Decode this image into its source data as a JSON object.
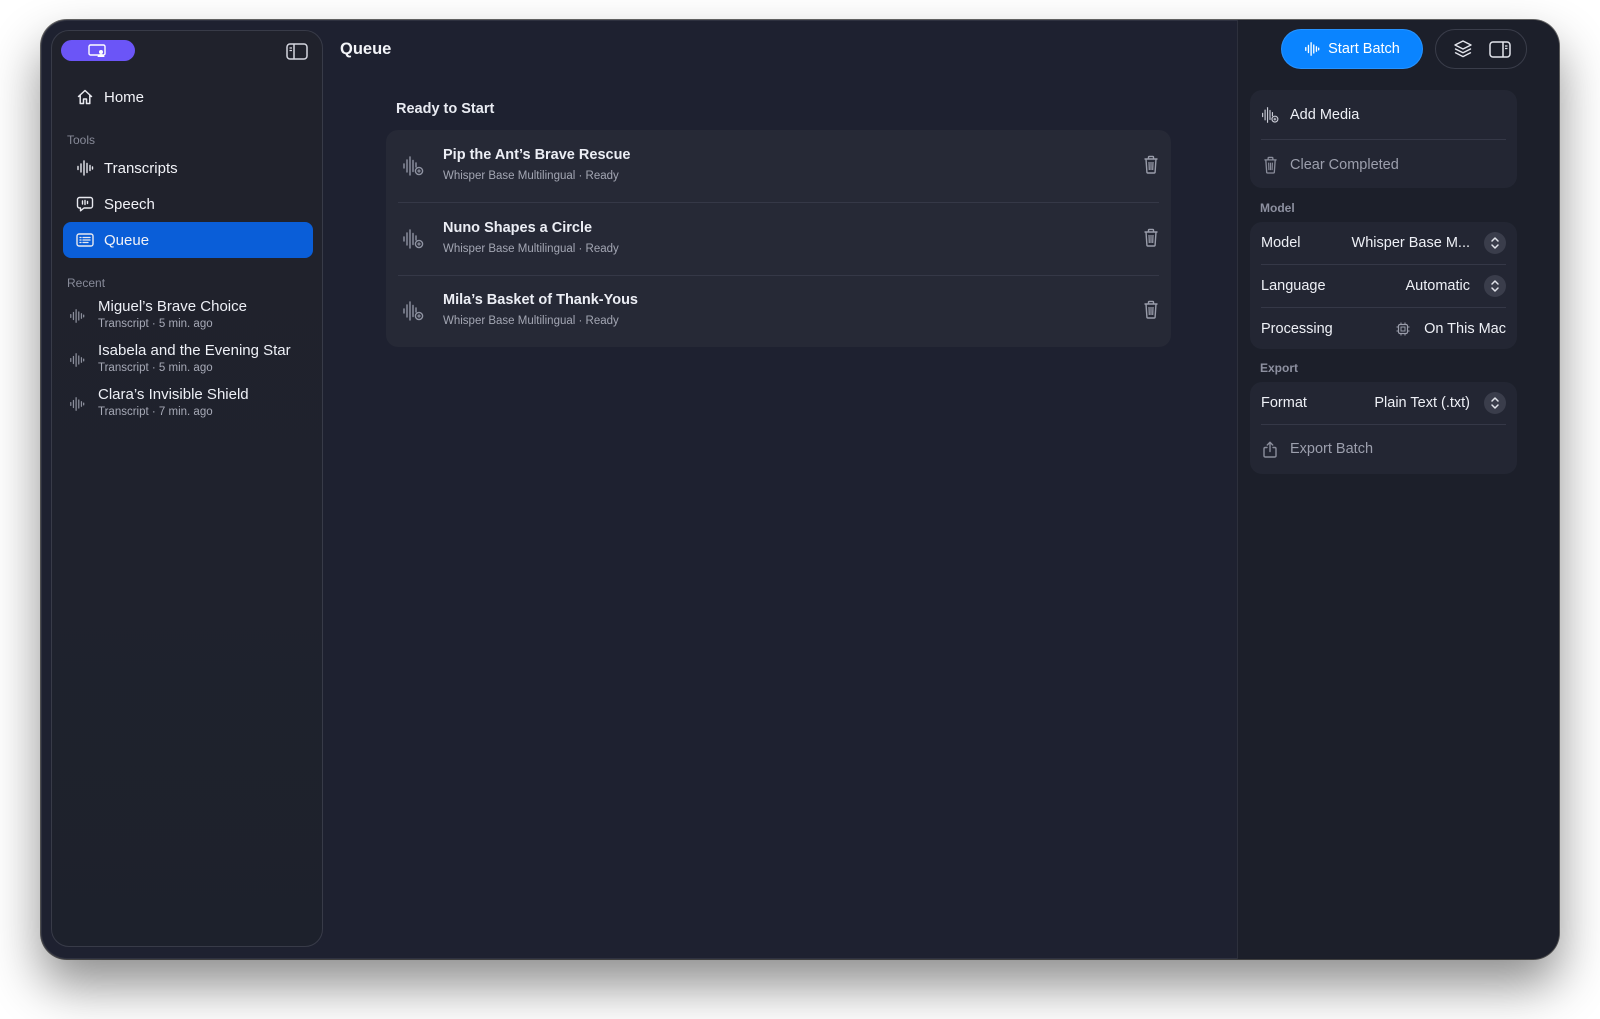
{
  "sidebar": {
    "nav": [
      {
        "label": "Home",
        "icon": "house-icon"
      },
      {
        "label": "Transcripts",
        "icon": "waveform-icon"
      },
      {
        "label": "Speech",
        "icon": "speech-bubble-icon"
      },
      {
        "label": "Queue",
        "icon": "queue-list-icon",
        "active": true
      }
    ],
    "tools_label": "Tools",
    "recent_label": "Recent",
    "recent": [
      {
        "title": "Miguel’s Brave Choice",
        "sub": "Transcript · 5 min. ago"
      },
      {
        "title": "Isabela and the Evening Star",
        "sub": "Transcript · 5 min. ago"
      },
      {
        "title": "Clara’s Invisible Shield",
        "sub": "Transcript · 7 min. ago"
      }
    ]
  },
  "main": {
    "title": "Queue",
    "section_heading": "Ready to Start",
    "items": [
      {
        "title": "Pip the Ant’s Brave Rescue",
        "sub": "Whisper Base Multilingual · Ready"
      },
      {
        "title": "Nuno Shapes a Circle",
        "sub": "Whisper Base Multilingual · Ready"
      },
      {
        "title": "Mila’s Basket of Thank-Yous",
        "sub": "Whisper Base Multilingual · Ready"
      }
    ]
  },
  "inspector": {
    "start_batch_label": "Start Batch",
    "add_media_label": "Add Media",
    "clear_completed_label": "Clear Completed",
    "model_section_label": "Model",
    "model_label": "Model",
    "model_value": "Whisper Base M...",
    "language_label": "Language",
    "language_value": "Automatic",
    "processing_label": "Processing",
    "processing_value": "On This Mac",
    "export_section_label": "Export",
    "format_label": "Format",
    "format_value": "Plain Text (.txt)",
    "export_batch_label": "Export Batch"
  },
  "colors": {
    "accent": "#0a84ff",
    "selection": "#0a5ed8",
    "app_badge": "#6b55f7",
    "window_bg": "#1e2130"
  }
}
